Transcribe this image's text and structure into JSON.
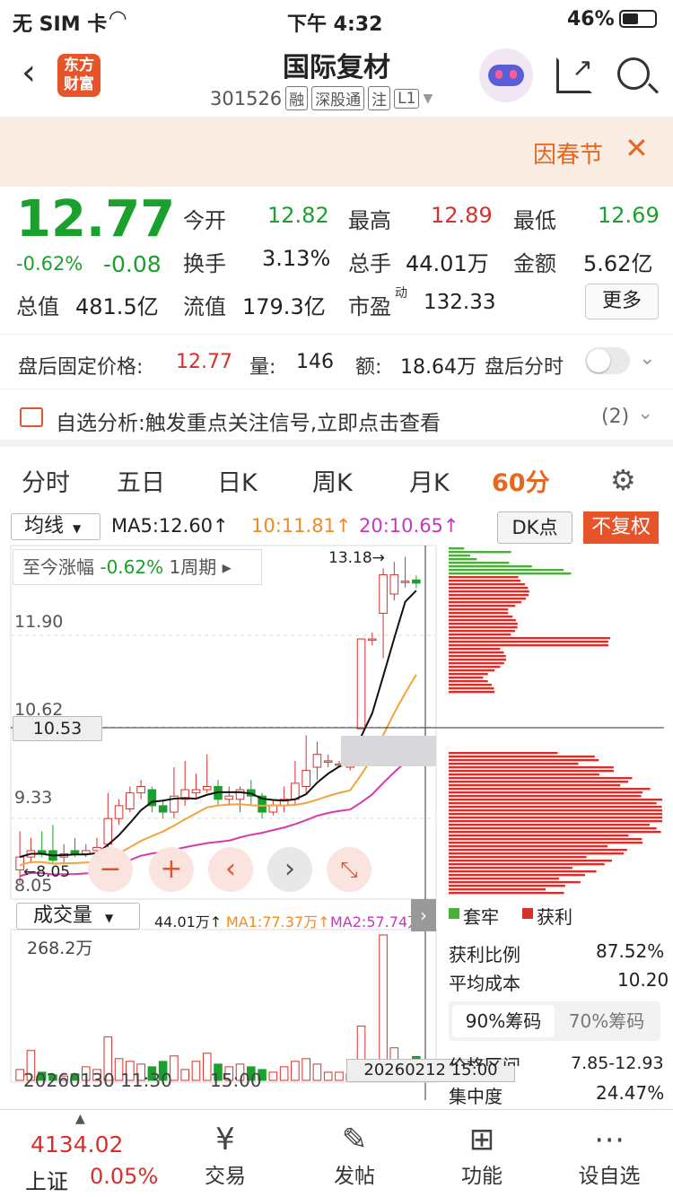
{
  "status": {
    "carrier": "无 SIM 卡",
    "time": "下午 4:32",
    "battery": "46%"
  },
  "header": {
    "logo": "东方\n财富",
    "title": "国际复材",
    "code": "301526",
    "tags": [
      "融",
      "深股通",
      "注",
      "L1"
    ]
  },
  "banner": {
    "text": "因春节"
  },
  "quote": {
    "price": "12.77",
    "change_pct": "-0.62%",
    "change": "-0.08",
    "open_label": "今开",
    "open": "12.82",
    "high_label": "最高",
    "high": "12.89",
    "low_label": "最低",
    "low": "12.69",
    "turnover_label": "换手",
    "turnover": "3.13%",
    "vol_label": "总手",
    "vol": "44.01万",
    "amount_label": "金额",
    "amount": "5.62亿",
    "mcap_label": "总值",
    "mcap": "481.5亿",
    "float_label": "流值",
    "float": "179.3亿",
    "pe_label": "市盈",
    "pe_sup": "动",
    "pe": "132.33",
    "more": "更多"
  },
  "after": {
    "label": "盘后固定价格:",
    "price": "12.77",
    "vol_label": "量:",
    "vol": "146",
    "amt_label": "额:",
    "amt": "18.64万",
    "time_label": "盘后分时"
  },
  "analysis": {
    "text": "自选分析:触发重点关注信号,立即点击查看",
    "count": "(2)"
  },
  "tabs": [
    "分时",
    "五日",
    "日K",
    "周K",
    "月K",
    "60分"
  ],
  "chart": {
    "ma_select": "均线",
    "ma5": "MA5:12.60↑",
    "ma10": "10:11.81↑",
    "ma20": "20:10.65↑",
    "dk": "DK点",
    "fq": "不复权",
    "range_label": "至今涨幅",
    "range_value": "-0.62%",
    "range_period": "1周期",
    "y_labels": [
      "11.90",
      "10.62",
      "9.33",
      "8.05"
    ],
    "cursor_price": "10.53",
    "max_label": "13.18→",
    "min_label": "←8.05",
    "vol_select": "成交量",
    "vol_now": "44.01万↑",
    "vol_ma1": "MA1:77.37万↑",
    "vol_ma2": "MA2:57.74万↑",
    "vol_max": "268.2万",
    "date_left": "20260130 11:30",
    "date_mid": "15:00",
    "date_cursor": "20260212 15:00"
  },
  "chips": {
    "legend_trap": "套牢",
    "legend_profit": "获利",
    "profit_ratio_label": "获利比例",
    "profit_ratio": "87.52%",
    "avg_cost_label": "平均成本",
    "avg_cost": "10.20",
    "tab90": "90%筹码",
    "tab70": "70%筹码",
    "range_label": "价格区间",
    "range": "7.85-12.93",
    "conc_label": "集中度",
    "conc": "24.47%"
  },
  "bottom": {
    "index_value": "4134.02",
    "index_name": "上证",
    "index_change": "0.05%",
    "items": [
      "交易",
      "发帖",
      "功能",
      "设自选"
    ]
  },
  "chart_data": {
    "type": "candlestick",
    "ylim": [
      7.9,
      13.3
    ],
    "candles": [
      [
        8.3,
        8.5,
        8.9,
        8.1
      ],
      [
        8.5,
        8.6,
        8.8,
        8.4
      ],
      [
        8.6,
        8.55,
        8.9,
        8.5
      ],
      [
        8.6,
        8.45,
        9.0,
        8.4
      ],
      [
        8.5,
        8.55,
        8.7,
        8.4
      ],
      [
        8.6,
        8.55,
        8.8,
        8.5
      ],
      [
        8.55,
        8.6,
        8.7,
        8.5
      ],
      [
        8.6,
        8.65,
        8.8,
        8.55
      ],
      [
        8.7,
        9.1,
        9.5,
        8.6
      ],
      [
        9.1,
        9.3,
        9.4,
        9.0
      ],
      [
        9.25,
        9.5,
        9.6,
        9.2
      ],
      [
        9.5,
        9.6,
        9.7,
        9.4
      ],
      [
        9.55,
        9.3,
        9.6,
        9.2
      ],
      [
        9.3,
        9.2,
        9.4,
        9.1
      ],
      [
        9.2,
        9.45,
        9.9,
        9.1
      ],
      [
        9.4,
        9.55,
        10.0,
        9.3
      ],
      [
        9.5,
        9.55,
        9.8,
        9.4
      ],
      [
        9.55,
        9.6,
        10.1,
        9.5
      ],
      [
        9.6,
        9.4,
        9.7,
        9.3
      ],
      [
        9.4,
        9.45,
        9.6,
        9.3
      ],
      [
        9.4,
        9.55,
        9.6,
        9.2
      ],
      [
        9.55,
        9.45,
        9.7,
        9.3
      ],
      [
        9.45,
        9.2,
        9.5,
        9.1
      ],
      [
        9.2,
        9.3,
        9.4,
        9.15
      ],
      [
        9.3,
        9.4,
        9.6,
        9.2
      ],
      [
        9.4,
        9.65,
        10.0,
        9.3
      ],
      [
        9.6,
        9.85,
        10.4,
        9.5
      ],
      [
        9.9,
        10.1,
        10.3,
        9.7
      ],
      [
        10.0,
        10.0,
        10.1,
        9.9
      ],
      [
        9.95,
        9.95,
        10.0,
        9.9
      ],
      [
        9.9,
        9.95,
        10.0,
        9.85
      ],
      [
        10.5,
        11.9,
        11.9,
        10.5
      ],
      [
        11.9,
        11.9,
        12.0,
        11.8
      ],
      [
        12.3,
        12.9,
        13.0,
        11.6
      ],
      [
        12.6,
        12.9,
        13.1,
        12.5
      ],
      [
        12.8,
        12.8,
        13.18,
        12.7
      ],
      [
        12.82,
        12.77,
        12.89,
        12.69
      ]
    ],
    "volumes": [
      20,
      55,
      15,
      10,
      8,
      12,
      25,
      20,
      80,
      40,
      35,
      30,
      25,
      35,
      45,
      20,
      35,
      50,
      30,
      25,
      30,
      25,
      20,
      15,
      25,
      35,
      40,
      30,
      15,
      15,
      12,
      100,
      30,
      268,
      60,
      35,
      44
    ]
  }
}
